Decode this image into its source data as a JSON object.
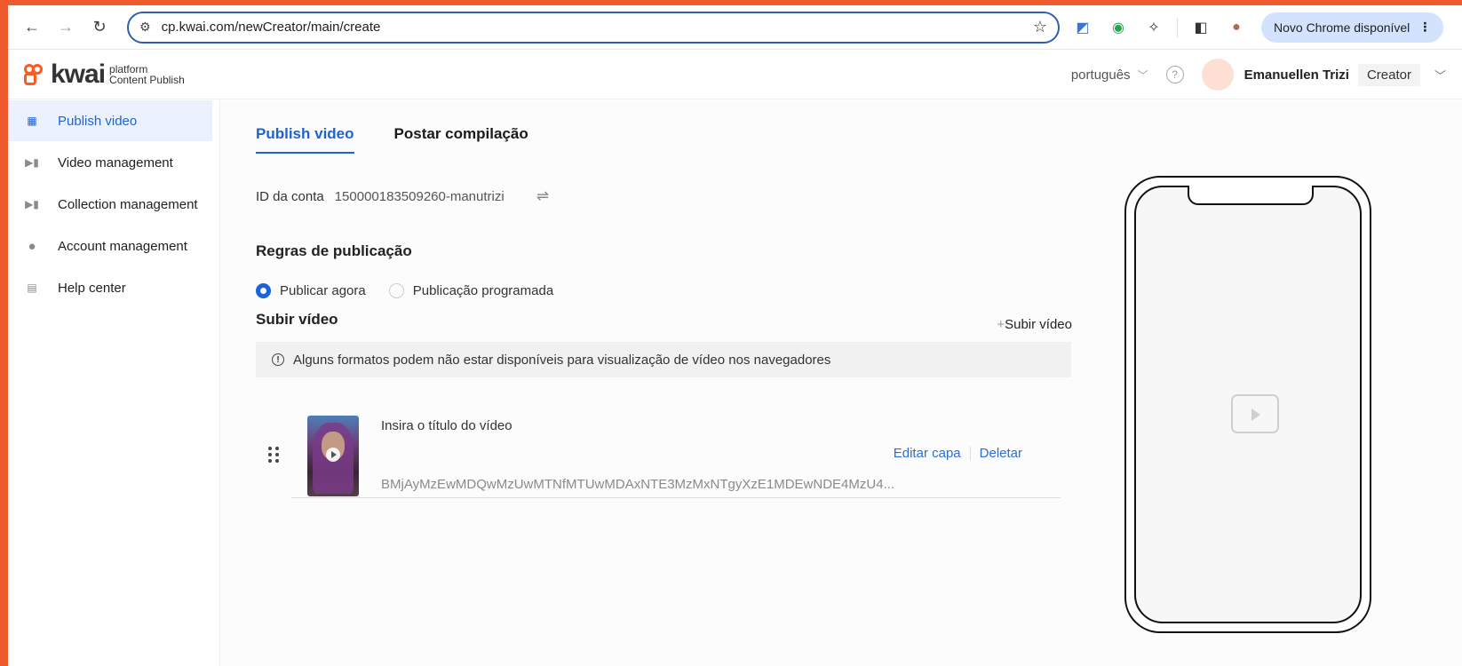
{
  "browser": {
    "url": "cp.kwai.com/newCreator/main/create",
    "update_label": "Novo Chrome disponível",
    "kebab": "⋮"
  },
  "header": {
    "logo_word": "kwai",
    "logo_sub1": "platform",
    "logo_sub2": "Content Publish",
    "language": "português",
    "help": "?",
    "user_name": "Emanuellen Trizi",
    "role": "Creator"
  },
  "sidebar": {
    "items": [
      {
        "label": "Publish video",
        "icon": "grid-icon"
      },
      {
        "label": "Video management",
        "icon": "video-icon"
      },
      {
        "label": "Collection management",
        "icon": "video-icon"
      },
      {
        "label": "Account management",
        "icon": "user-icon"
      },
      {
        "label": "Help center",
        "icon": "search-doc-icon"
      }
    ]
  },
  "main": {
    "tabs": [
      "Publish video",
      "Postar compilação"
    ],
    "account_label": "ID da conta",
    "account_value": "150000183509260-manutrizi",
    "rules_title": "Regras de publicação",
    "radio_now": "Publicar agora",
    "radio_scheduled": "Publicação programada",
    "upload_title": "Subir vídeo",
    "upload_link": "Subir vídeo",
    "notice": "Alguns formatos podem não estar disponíveis para visualização de vídeo nos navegadores",
    "video": {
      "title_placeholder": "Insira o título do vídeo",
      "edit_cover": "Editar capa",
      "delete": "Deletar",
      "id": "BMjAyMzEwMDQwMzUwMTNfMTUwMDAxNTE3MzMxNTgyXzE1MDEwNDE4MzU4..."
    }
  },
  "colors": {
    "accent": "#1d63d6",
    "brand": "#ff5a1f",
    "frame": "#ee5a2b"
  }
}
